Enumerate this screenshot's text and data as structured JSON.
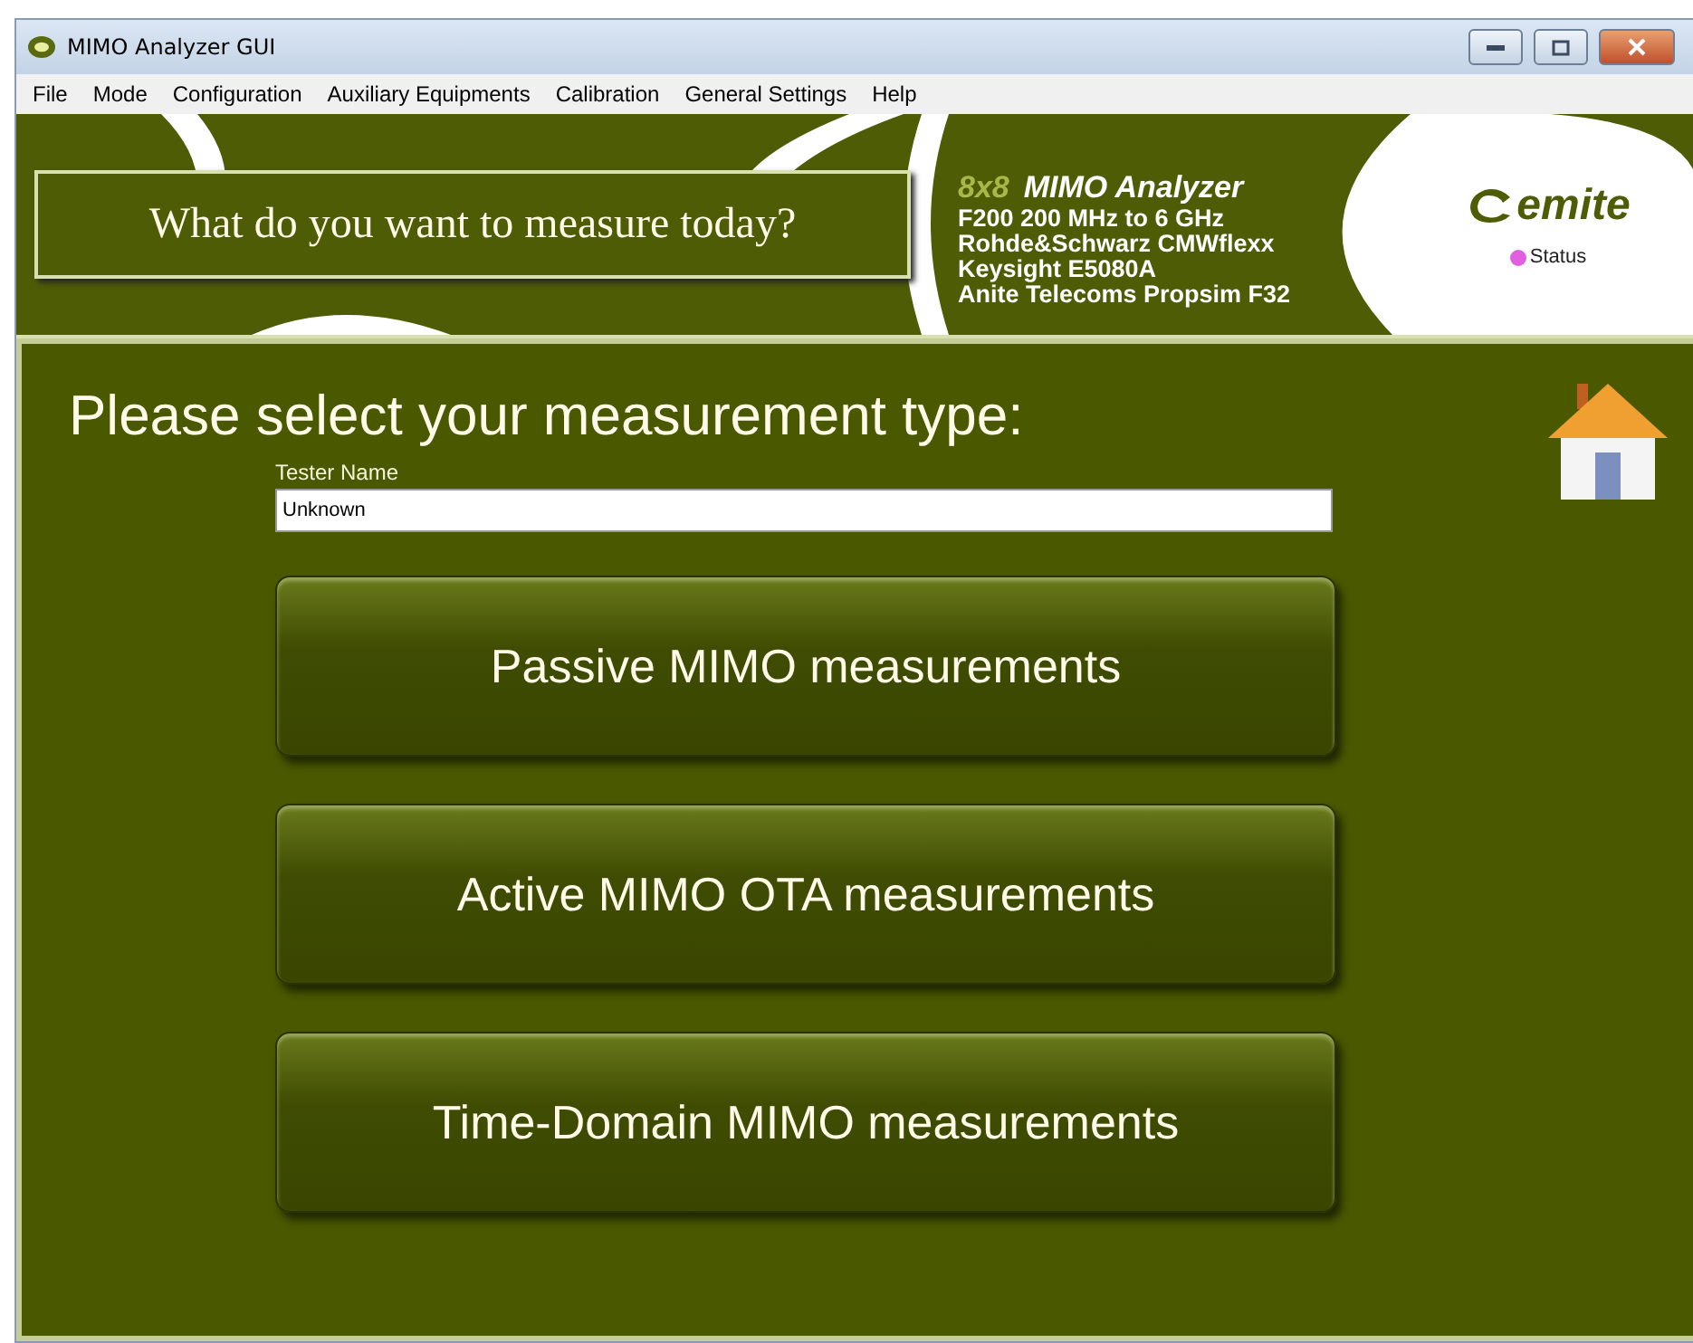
{
  "window": {
    "title": "MIMO Analyzer GUI"
  },
  "menu": [
    "File",
    "Mode",
    "Configuration",
    "Auxiliary Equipments",
    "Calibration",
    "General Settings",
    "Help"
  ],
  "banner": {
    "question": "What do you want to measure today?",
    "product_prefix": "8x8",
    "product": "MIMO Analyzer",
    "specs": [
      "F200 200 MHz to 6 GHz",
      "Rohde&Schwarz  CMWflexx",
      "Keysight  E5080A",
      "Anite Telecoms  Propsim F32"
    ],
    "logo": "emite",
    "status": {
      "label": "Status",
      "color": "#e060e0"
    }
  },
  "heading": "Please select your measurement type:",
  "tester": {
    "label": "Tester Name",
    "value": "Unknown"
  },
  "buttons": [
    "Passive MIMO measurements",
    "Active MIMO OTA measurements",
    "Time-Domain MIMO measurements"
  ]
}
